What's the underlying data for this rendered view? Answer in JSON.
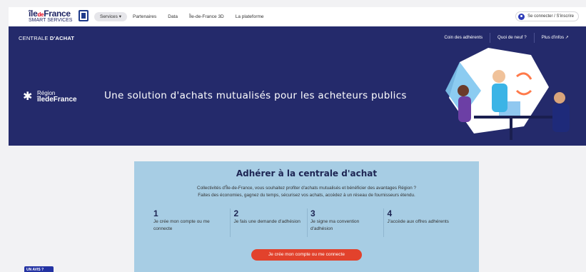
{
  "header": {
    "logo_line1_part1": "île",
    "logo_line1_part2": "de",
    "logo_line1_part3": "France",
    "logo_line2": "SMART SERVICES",
    "nav": [
      {
        "label": "Services ▾",
        "active": true
      },
      {
        "label": "Partenaires",
        "active": false
      },
      {
        "label": "Data",
        "active": false
      },
      {
        "label": "Île-de-France 3D",
        "active": false
      },
      {
        "label": "La plateforme",
        "active": false
      }
    ],
    "connect_label": "Se connecter / S'inscrire"
  },
  "hero": {
    "brand_prefix": "CENTRALE ",
    "brand_bold": "D'ACHAT",
    "links": [
      "Coin des adhérents",
      "Quoi de neuf ?",
      "Plus d'infos ↗"
    ],
    "region_line1": "Région",
    "region_line2": "îledeFrance",
    "tagline": "Une solution d'achats mutualisés pour les acheteurs publics"
  },
  "card": {
    "title": "Adhérer à la centrale d'achat",
    "intro_line1": "Collectivités d'Île-de-France, vous souhaitez profiter d'achats mutualisés et bénéficier des avantages Région ?",
    "intro_line2": "Faites des économies, gagnez du temps, sécurisez vos achats, accédez à un réseau de fournisseurs étendu.",
    "steps": [
      {
        "num": "1",
        "text": "Je crée mon compte ou me connecte"
      },
      {
        "num": "2",
        "text": "Je fais une demande d'adhésion"
      },
      {
        "num": "3",
        "text": "Je signe ma convention d'adhésion"
      },
      {
        "num": "4",
        "text": "J'accède aux offres adhérents"
      }
    ],
    "cta_label": "Je crée mon compte ou me connecte"
  },
  "feedback_label": "UN AVIS ?",
  "colors": {
    "hero_bg": "#242a6b",
    "card_bg": "#a7cde4",
    "cta": "#e2422c",
    "accent": "#2f3db8"
  }
}
